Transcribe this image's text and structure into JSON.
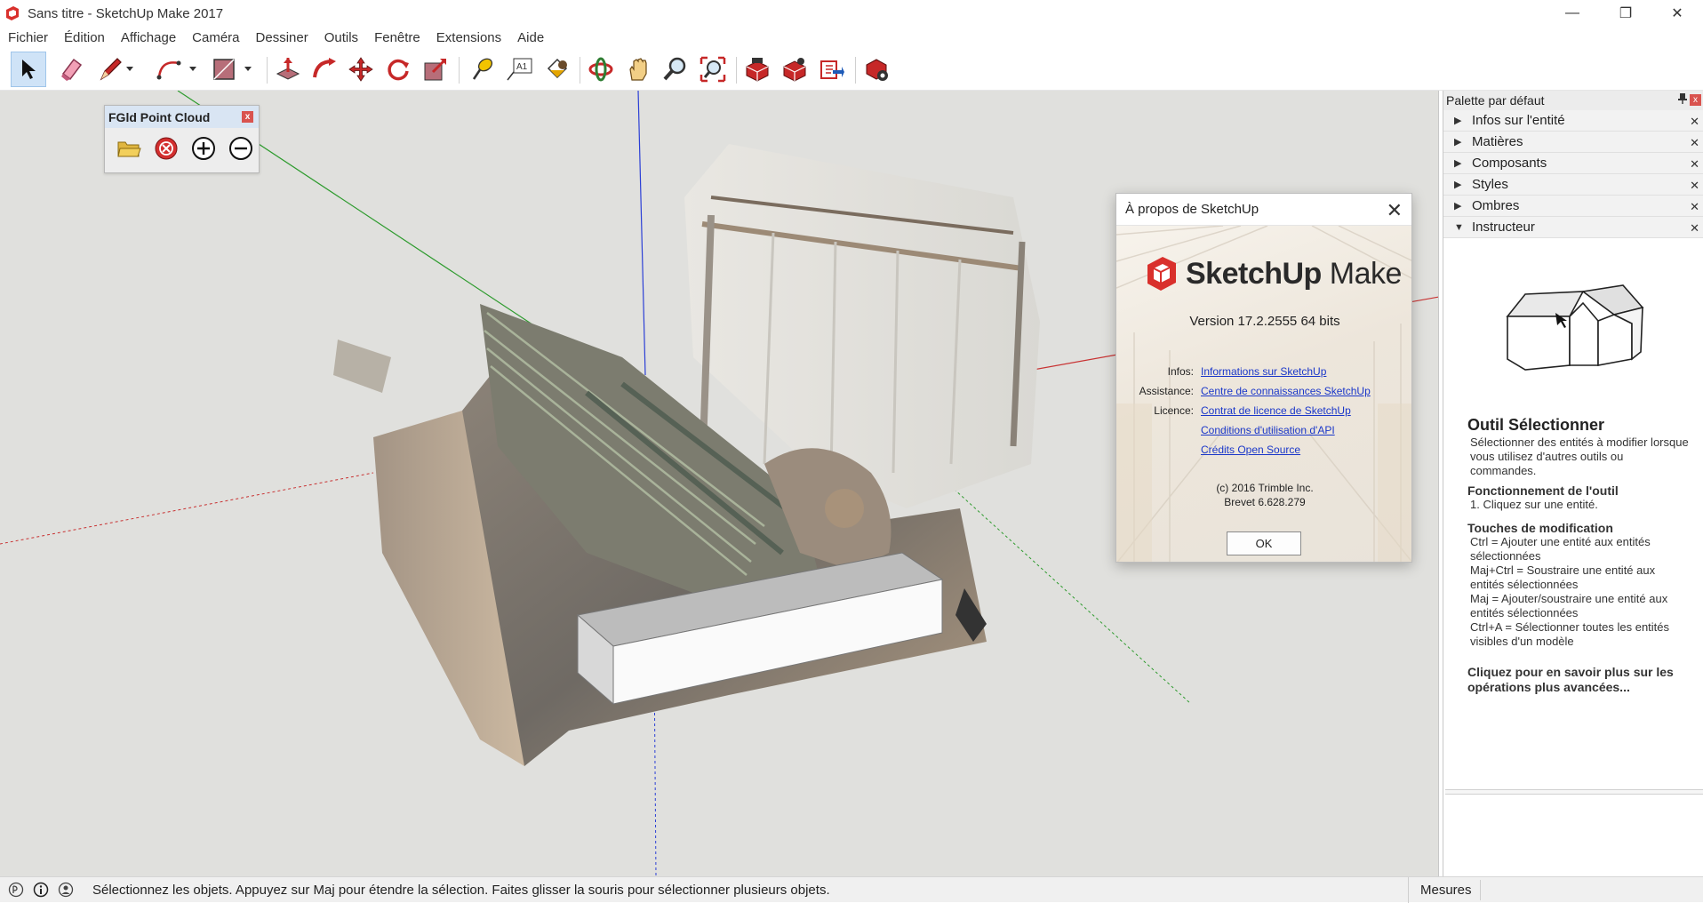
{
  "window": {
    "title": "Sans titre - SketchUp Make 2017",
    "controls": {
      "minimize": "—",
      "maximize": "❐",
      "close": "✕"
    }
  },
  "menubar": {
    "items": [
      "Fichier",
      "Édition",
      "Affichage",
      "Caméra",
      "Dessiner",
      "Outils",
      "Fenêtre",
      "Extensions",
      "Aide"
    ]
  },
  "toolbar": {
    "tools": [
      "select-icon",
      "eraser-icon",
      "pencil-icon",
      "arc-icon",
      "rectangle-icon",
      "push-pull-icon",
      "follow-me-icon",
      "move-icon",
      "rotate-icon",
      "scale-icon",
      "tape-measure-icon",
      "text-icon",
      "paint-bucket-icon",
      "orbit-icon",
      "pan-icon",
      "zoom-icon",
      "zoom-extents-icon",
      "warehouse-icon",
      "extension-warehouse-icon",
      "send-to-layout-icon",
      "extension-manager-icon"
    ],
    "text_tool_label": "A1"
  },
  "fgld_panel": {
    "title": "FGld Point Cloud",
    "close": "x",
    "buttons": [
      "open-folder-icon",
      "stop-icon",
      "plus-icon",
      "minus-icon"
    ]
  },
  "about_dialog": {
    "title": "À propos de SketchUp",
    "close": "✕",
    "logo_bold": "SketchUp",
    "logo_light": "Make",
    "version": "Version 17.2.2555 64 bits",
    "rows": [
      {
        "key": "Infos:",
        "value": "Informations sur SketchUp"
      },
      {
        "key": "Assistance:",
        "value": "Centre de connaissances SketchUp"
      },
      {
        "key": "Licence:",
        "value": "Contrat de licence de SketchUp"
      },
      {
        "key": "",
        "value": "Conditions d'utilisation d'API"
      },
      {
        "key": "",
        "value": "Crédits Open Source"
      }
    ],
    "copyright": "(c) 2016 Trimble Inc.",
    "patent": "Brevet 6.628.279",
    "ok": "OK"
  },
  "palette": {
    "title": "Palette par défaut",
    "pin": "📌",
    "close": "x",
    "sections": [
      {
        "label": "Infos sur l'entité",
        "expanded": false
      },
      {
        "label": "Matières",
        "expanded": false
      },
      {
        "label": "Composants",
        "expanded": false
      },
      {
        "label": "Styles",
        "expanded": false
      },
      {
        "label": "Ombres",
        "expanded": false
      },
      {
        "label": "Instructeur",
        "expanded": true
      }
    ],
    "instructor": {
      "title": "Outil Sélectionner",
      "description": "Sélectionner des entités à modifier lorsque vous utilisez d'autres outils ou commandes.",
      "op_heading": "Fonctionnement de l'outil",
      "op_step": "1. Cliquez sur une entité.",
      "mods_heading": "Touches de modification",
      "mods": [
        "Ctrl = Ajouter une entité aux entités sélectionnées",
        "Maj+Ctrl = Soustraire une entité aux entités sélectionnées",
        "Maj = Ajouter/soustraire une entité aux entités sélectionnées",
        "Ctrl+A = Sélectionner toutes les entités visibles d'un modèle"
      ],
      "more": "Cliquez pour en savoir plus sur les opérations plus avancées..."
    }
  },
  "statusbar": {
    "text": "Sélectionnez les objets. Appuyez sur Maj pour étendre la sélection. Faites glisser la souris pour sélectionner plusieurs objets.",
    "measures_label": "Mesures",
    "measures_value": ""
  },
  "colors": {
    "accent_red": "#d9302c",
    "link_blue": "#1a37c9",
    "viewport_bg": "#e0e0dd",
    "axis_red": "#c83232",
    "axis_green": "#2e9b2e",
    "axis_blue": "#2b3fd6"
  }
}
